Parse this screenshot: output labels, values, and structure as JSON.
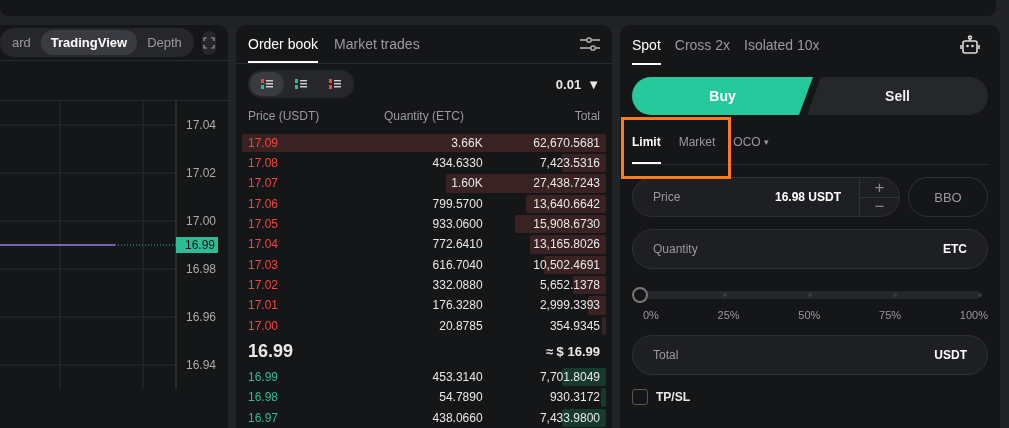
{
  "chart_panel": {
    "view_tabs": [
      {
        "label": "ard",
        "selected": false
      },
      {
        "label": "TradingView",
        "selected": true
      },
      {
        "label": "Depth",
        "selected": false
      }
    ],
    "chart_data": {
      "type": "line",
      "grid": true,
      "ylim": [
        16.93,
        17.05
      ],
      "yticks": [
        {
          "value": 16.94,
          "label": "16.94"
        },
        {
          "value": 16.96,
          "label": "16.96"
        },
        {
          "value": 16.98,
          "label": "16.98"
        },
        {
          "value": 17.0,
          "label": "17.00"
        },
        {
          "value": 17.02,
          "label": "17.02"
        },
        {
          "value": 17.04,
          "label": "17.04"
        }
      ],
      "series": [
        {
          "color": "#9b7be0",
          "values": [
            16.99,
            16.99,
            16.99,
            16.99,
            16.99
          ]
        }
      ]
    },
    "last_price": "16.99"
  },
  "order_book": {
    "tabs": [
      {
        "label": "Order book",
        "selected": true
      },
      {
        "label": "Market trades",
        "selected": false
      }
    ],
    "views": [
      {
        "kind": "both",
        "selected": true
      },
      {
        "kind": "bids",
        "selected": false
      },
      {
        "kind": "asks",
        "selected": false
      }
    ],
    "precision": "0.01",
    "caret": "▼",
    "columns": [
      "Price (USDT)",
      "Quantity (ETC)",
      "Total"
    ],
    "asks": [
      {
        "price": "17.09",
        "quantity": "3.66K",
        "total": "62,670.5681",
        "level": 1
      },
      {
        "price": "17.08",
        "quantity": "434.6330",
        "total": "7,423.5316",
        "level": 0.12
      },
      {
        "price": "17.07",
        "quantity": "1.60K",
        "total": "27,438.7243",
        "level": 0.44
      },
      {
        "price": "17.06",
        "quantity": "799.5700",
        "total": "13,640.6642",
        "level": 0.22
      },
      {
        "price": "17.05",
        "quantity": "933.0600",
        "total": "15,908.6730",
        "level": 0.25
      },
      {
        "price": "17.04",
        "quantity": "772.6410",
        "total": "13,165.8026",
        "level": 0.21
      },
      {
        "price": "17.03",
        "quantity": "616.7040",
        "total": "10,502.4691",
        "level": 0.17
      },
      {
        "price": "17.02",
        "quantity": "332.0880",
        "total": "5,652.1378",
        "level": 0.09
      },
      {
        "price": "17.01",
        "quantity": "176.3280",
        "total": "2,999.3393",
        "level": 0.05
      },
      {
        "price": "17.00",
        "quantity": "20.8785",
        "total": "354.9345",
        "level": 0.01
      }
    ],
    "mid_price": "16.99",
    "mid_usd": "≈ $ 16.99",
    "bids": [
      {
        "price": "16.99",
        "quantity": "453.3140",
        "total": "7,701.8049",
        "level": 0.12
      },
      {
        "price": "16.98",
        "quantity": "54.7890",
        "total": "930.3172",
        "level": 0.015
      },
      {
        "price": "16.97",
        "quantity": "438.0660",
        "total": "7,433.9800",
        "level": 0.12
      }
    ]
  },
  "trade_panel": {
    "margin_tabs": [
      {
        "label": "Spot",
        "selected": true
      },
      {
        "label": "Cross 2x",
        "selected": false
      },
      {
        "label": "Isolated 10x",
        "selected": false
      }
    ],
    "sides": [
      {
        "label": "Buy",
        "kind": "buy",
        "selected": true
      },
      {
        "label": "Sell",
        "kind": "sell",
        "selected": false
      }
    ],
    "order_types": [
      {
        "label": "Limit",
        "selected": true
      },
      {
        "label": "Market",
        "selected": false
      },
      {
        "label": "OCO",
        "selected": false,
        "caret": "▾"
      }
    ],
    "order_type_highlight": true,
    "price_field": {
      "label": "Price",
      "value": "16.98",
      "unit": "USDT",
      "plus": "+",
      "minus": "−"
    },
    "bbo": "BBO",
    "quantity_field": {
      "label": "Quantity",
      "unit": "ETC"
    },
    "slider": {
      "level": 0,
      "marks": [
        "0%",
        "25%",
        "50%",
        "75%",
        "100%"
      ]
    },
    "total_field": {
      "label": "Total",
      "unit": "USDT"
    },
    "tpsl": {
      "label": "TP/SL",
      "checked": false
    }
  }
}
